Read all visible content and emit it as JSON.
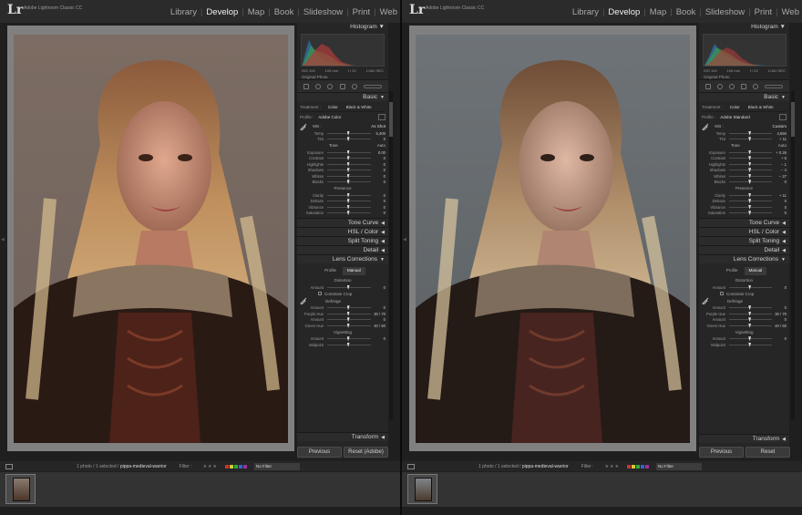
{
  "app": {
    "logo": "Lr",
    "name": "Adobe Lightroom Classic CC"
  },
  "modules": [
    "Library",
    "Develop",
    "Map",
    "Book",
    "Slideshow",
    "Print",
    "Web"
  ],
  "active_module": "Develop",
  "left": {
    "histogram": {
      "title": "Histogram",
      "meta": [
        "ISO 100",
        "100 mm",
        "f / 22",
        "1/160 SEC"
      ],
      "original": "Original Photo"
    },
    "basic": {
      "title": "Basic",
      "treatment_label": "Treatment :",
      "treatment_color": "Color",
      "treatment_bw": "Black & White",
      "profile_label": "Profile :",
      "profile_value": "Adobe Color",
      "wb_label": "WB :",
      "wb_value": "As Shot",
      "sliders_wb": [
        {
          "label": "Temp",
          "value": "5,400"
        },
        {
          "label": "Tint",
          "value": "0"
        }
      ],
      "tone_label": "Tone",
      "tone_auto": "Auto",
      "sliders_tone": [
        {
          "label": "Exposure",
          "value": "0.00"
        },
        {
          "label": "Contrast",
          "value": "0"
        },
        {
          "label": "Highlights",
          "value": "0"
        },
        {
          "label": "Shadows",
          "value": "0"
        },
        {
          "label": "Whites",
          "value": "0"
        },
        {
          "label": "Blacks",
          "value": "0"
        }
      ],
      "presence_label": "Presence",
      "sliders_presence": [
        {
          "label": "Clarity",
          "value": "0"
        },
        {
          "label": "Dehaze",
          "value": "0"
        },
        {
          "label": "Vibrance",
          "value": "0"
        },
        {
          "label": "Saturation",
          "value": "0"
        }
      ]
    },
    "panels": [
      "Tone Curve",
      "HSL / Color",
      "Split Toning",
      "Detail"
    ],
    "lens": {
      "title": "Lens Corrections",
      "tab_profile": "Profile",
      "tab_manual": "Manual",
      "distortion_label": "Distortion",
      "sliders_distortion": [
        {
          "label": "Amount",
          "value": "0"
        }
      ],
      "constrain": "Constrain Crop",
      "defringe_label": "Defringe",
      "sliders_defringe": [
        {
          "label": "Amount",
          "value": "0"
        },
        {
          "label": "Purple Hue",
          "value": "30 / 70"
        },
        {
          "label": "Amount",
          "value": "0"
        },
        {
          "label": "Green Hue",
          "value": "40 / 60"
        }
      ],
      "vignetting_label": "Vignetting",
      "sliders_vignetting": [
        {
          "label": "Amount",
          "value": "0"
        },
        {
          "label": "Midpoint",
          "value": ""
        }
      ]
    },
    "transform": "Transform",
    "btn_previous": "Previous",
    "btn_reset": "Reset (Adobe)",
    "toolbar": {
      "info": "1 photo / 1 selected /",
      "filename": "pippa-medieval-warrior",
      "filter": "Filter :",
      "nofilter": "No Filter"
    }
  },
  "right": {
    "histogram": {
      "title": "Histogram",
      "meta": [
        "ISO 100",
        "100 mm",
        "f / 22",
        "1/160 SEC"
      ],
      "original": "Original Photo"
    },
    "basic": {
      "title": "Basic",
      "treatment_label": "Treatment :",
      "treatment_color": "Color",
      "treatment_bw": "Black & White",
      "profile_label": "Profile :",
      "profile_value": "Adobe Standard",
      "wb_label": "WB :",
      "wb_value": "Custom",
      "sliders_wb": [
        {
          "label": "Temp",
          "value": "4,650"
        },
        {
          "label": "Tint",
          "value": "+ 11"
        }
      ],
      "tone_label": "Tone",
      "tone_auto": "Auto",
      "sliders_tone": [
        {
          "label": "Exposure",
          "value": "+ 0.26"
        },
        {
          "label": "Contrast",
          "value": "+ 5"
        },
        {
          "label": "Highlights",
          "value": "− 1"
        },
        {
          "label": "Shadows",
          "value": "− 4"
        },
        {
          "label": "Whites",
          "value": "− 27"
        },
        {
          "label": "Blacks",
          "value": "0"
        }
      ],
      "presence_label": "Presence",
      "sliders_presence": [
        {
          "label": "Clarity",
          "value": "+ 11"
        },
        {
          "label": "Dehaze",
          "value": "0"
        },
        {
          "label": "Vibrance",
          "value": "0"
        },
        {
          "label": "Saturation",
          "value": "0"
        }
      ]
    },
    "panels": [
      "Tone Curve",
      "HSL / Color",
      "Split Toning",
      "Detail"
    ],
    "lens": {
      "title": "Lens Corrections",
      "tab_profile": "Profile",
      "tab_manual": "Manual",
      "distortion_label": "Distortion",
      "sliders_distortion": [
        {
          "label": "Amount",
          "value": "0"
        }
      ],
      "constrain": "Constrain Crop",
      "defringe_label": "Defringe",
      "sliders_defringe": [
        {
          "label": "Amount",
          "value": "0"
        },
        {
          "label": "Purple Hue",
          "value": "30 / 70"
        },
        {
          "label": "Amount",
          "value": "0"
        },
        {
          "label": "Green Hue",
          "value": "40 / 60"
        }
      ],
      "vignetting_label": "Vignetting",
      "sliders_vignetting": [
        {
          "label": "Amount",
          "value": "0"
        },
        {
          "label": "Midpoint",
          "value": ""
        }
      ]
    },
    "transform": "Transform",
    "btn_previous": "Previous",
    "btn_reset": "Reset",
    "toolbar": {
      "info": "1 photo / 1 selected /",
      "filename": "pippa-medieval-warrior",
      "filter": "Filter :",
      "nofilter": "No Filter"
    }
  }
}
